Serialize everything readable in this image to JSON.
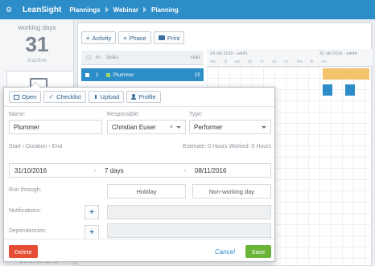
{
  "app": {
    "brand": "LeanSight",
    "breadcrumbs": [
      "Plannings",
      "Webinar",
      "Planning"
    ]
  },
  "sidebar": {
    "working_days_label": "working days",
    "working_days_value": "31",
    "status": "inactive",
    "bottom_label": "CONTRACTS"
  },
  "toolbar": {
    "activity": "Activity",
    "phase": "Phase",
    "print": "Print"
  },
  "task_list": {
    "header_nr": "nr.",
    "header_tasks": "tasks",
    "header_start": "start",
    "rows": [
      {
        "index": "1",
        "name": "Plummer",
        "count": "15"
      }
    ]
  },
  "gantt": {
    "weeks": [
      "24 okt 2016 - wk43",
      "31 okt 2016 - wk44"
    ],
    "days": [
      "ma",
      "di",
      "wo",
      "do",
      "vr",
      "za",
      "zo",
      "ma",
      "di",
      "wo"
    ]
  },
  "dialog": {
    "tabs": [
      "Open",
      "Checklist",
      "Upload",
      "Profile"
    ],
    "name_label": "Name:",
    "name_value": "Plummer",
    "responsible_label": "Responsible:",
    "responsible_value": "Christian Euser",
    "type_label": "Type:",
    "type_value": "Performer",
    "sequence_label": "Start › Duration › End",
    "estimate_text": "Estimate: 0 Hours Worked: 0 Hours",
    "start": "31/10/2016",
    "duration": "7 days",
    "end": "08/11/2016",
    "run_through_label": "Run through:",
    "holiday": "Holiday",
    "non_working_day": "Non-working day",
    "notifications_label": "Notifications:",
    "dependencies_label": "Dependencies:",
    "delete": "Delete",
    "cancel": "Cancel",
    "save": "Save"
  },
  "colors": {
    "topbar": "#2d8dc8",
    "delete": "#e54e35",
    "save": "#6ab43a",
    "bar_orange": "#f3c36b",
    "bar_blue": "#2d8dc8"
  }
}
